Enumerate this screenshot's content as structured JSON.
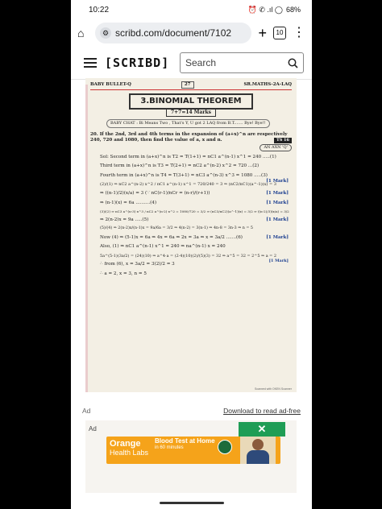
{
  "status": {
    "time": "10:22",
    "battery": "68%",
    "icons": "⏰ ✆ .ıl ◯"
  },
  "browser": {
    "url": "scribd.com/document/7102",
    "tab_count": "10"
  },
  "scribd": {
    "logo": "[SCRIBD]",
    "search_placeholder": "Search"
  },
  "doc": {
    "header_left": "BABY BULLET-Q",
    "page_number": "27",
    "header_right": "SR.MATHS-2A-LAQ",
    "chapter_title": "3.BINOMIAL THEOREM",
    "marks": "7+7=14 Marks",
    "baby_chat": "BABY CHAT : Bi Means Two , That's Y, U got 2 LAQ from B.T....... Bye! Bye!!",
    "q_number": "20.",
    "question": "If the 2nd, 3rd and 4th terms in the expansion of (a+x)^n are respectively 240, 720 and 1080, then find the value of a, x and n.",
    "ts_tag": "TS 16",
    "an_axn": "AN AXN 'Q'",
    "lines": [
      "Sol: Second term in (a+x)^n is T2 = T(1+1) = nC1 a^(n-1) x^1 = 240 .....(1)",
      "Third term in (a+x)^n is T3 = T(2+1) = nC2 a^(n-2) x^2 = 720 ...(2)",
      "Fourth term in (a+x)^n is T4 = T(3+1) = nC3 a^(n-3) x^3 = 1080 .....(3)",
      "(2)/(1) ⇒ nC2 a^(n-2) x^2 / nC1 a^(n-1) x^1 = 720/240 = 3 ⇒ (nC2/nC1)(a^-1)(x) = 3",
      "⇒ ((n-1)/2)(x/a) = 3   (∵ nC(r-1)/nCr = (n-r)/(r+1))",
      "⇒ (n-1)(x) = 6a   ..........(4)",
      "(3)/(2) ⇒ nC3 a^(n-3) x^3 / nC2 a^(n-2) x^2 = 1080/720 = 3/2 ⇒ (nC3/nC2)(a^-1)(x) = 3/2 ⇒ ((n-2)/3)(x/a) = 3/2",
      "⇒ 2(n-2)x = 9a .....(5)",
      "(5)/(4) ⇒ 2(n-2)x/(n-1)x = 9a/6a = 3/2 ⇒ 4(n-2) = 3(n-1) ⇒ 4n-8 = 3n-3 ⇒ n = 5",
      "Now (4) ⇒ (5-1)x = 6a ⇒ 4x = 6a ⇒ 2x = 3a ⇒ x = 3a/2 .......(6)",
      "Also, (1) ⇒ nC1 a^(n-1) x^1 = 240 ⇒ na^(n-1) x = 240",
      "5a^(5-1)(3a/2) = (24)(10) ⇒ a^4·a = (2·4)(10)(2)/(5)(3) = 32 ⇒ a^5 = 32 = 2^5 ⇒ a = 2",
      "∴ from (6), x = 3a/2 = 3(2)/2 = 3",
      "∴ a = 2, x = 3, n = 5"
    ],
    "mark_label": "[1 Mark]",
    "scanner_note": "Scanned with OKEN Scanner"
  },
  "ad": {
    "label": "Ad",
    "download_link": "Download to read ad-free",
    "small_label": "Ad",
    "close": "✕",
    "brand_line1": "Orange",
    "brand_line2": "Health Labs",
    "promo_line1": "Blood Test at Home",
    "promo_line2": "in 60 minutes"
  }
}
